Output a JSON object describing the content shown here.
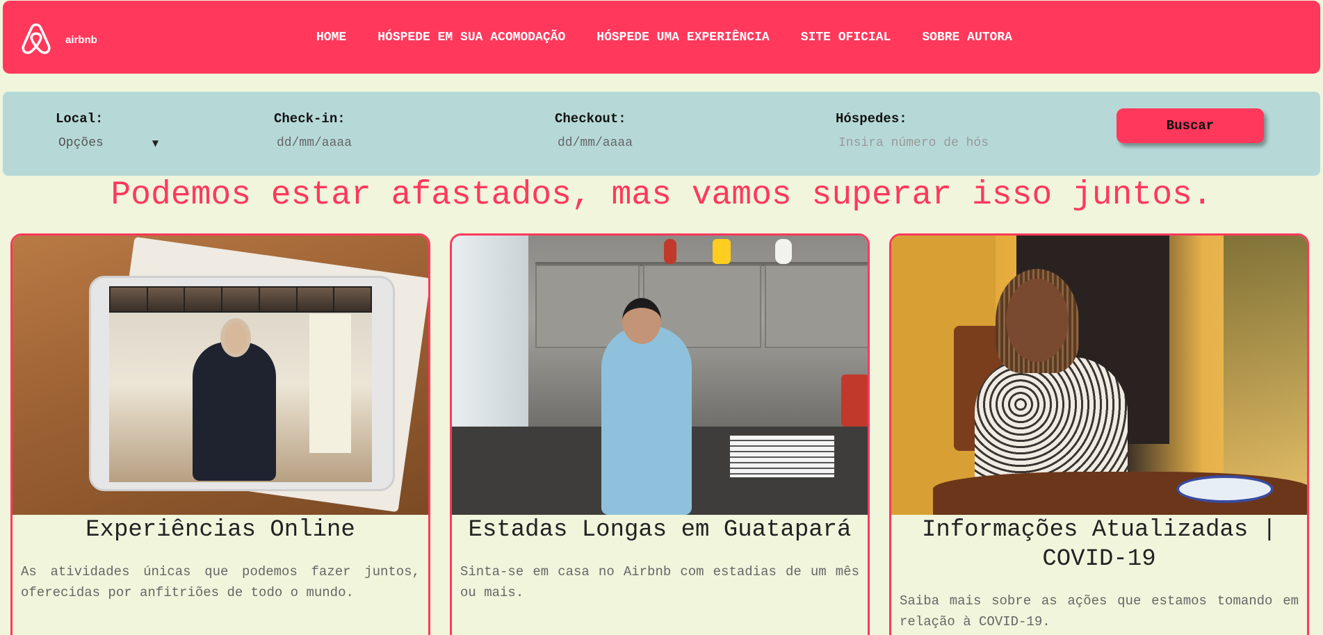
{
  "header": {
    "logo_text": "airbnb",
    "nav": [
      "HOME",
      "HÓSPEDE EM SUA ACOMODAÇÃO",
      "HÓSPEDE UMA EXPERIÊNCIA",
      "SITE OFICIAL",
      "SOBRE AUTORA"
    ]
  },
  "search": {
    "local_label": "Local:",
    "local_value": "Opções",
    "checkin_label": "Check-in:",
    "checkin_value": "dd/mm/aaaa",
    "checkout_label": "Checkout:",
    "checkout_value": "dd/mm/aaaa",
    "guests_label": "Hóspedes:",
    "guests_placeholder": "Insira número de hós",
    "button": "Buscar"
  },
  "tagline": "Podemos estar afastados, mas vamos superar isso juntos.",
  "cards": [
    {
      "title": "Experiências Online",
      "desc": "As atividades únicas que podemos fazer juntos, oferecidas por anfitriões de todo o mundo."
    },
    {
      "title": "Estadas Longas em Guatapará",
      "desc": "Sinta-se em casa no Airbnb com estadias de um mês ou mais."
    },
    {
      "title": "Informações Atualizadas | COVID-19",
      "desc": "Saiba mais sobre as ações que estamos tomando em relação à COVID-19."
    }
  ],
  "colors": {
    "brand": "#ff385c",
    "background": "#f0f5dc",
    "search_bg": "#b6d9d8"
  },
  "icons": {
    "logo": "airbnb-logo-icon",
    "select_caret": "caret-down-icon"
  }
}
